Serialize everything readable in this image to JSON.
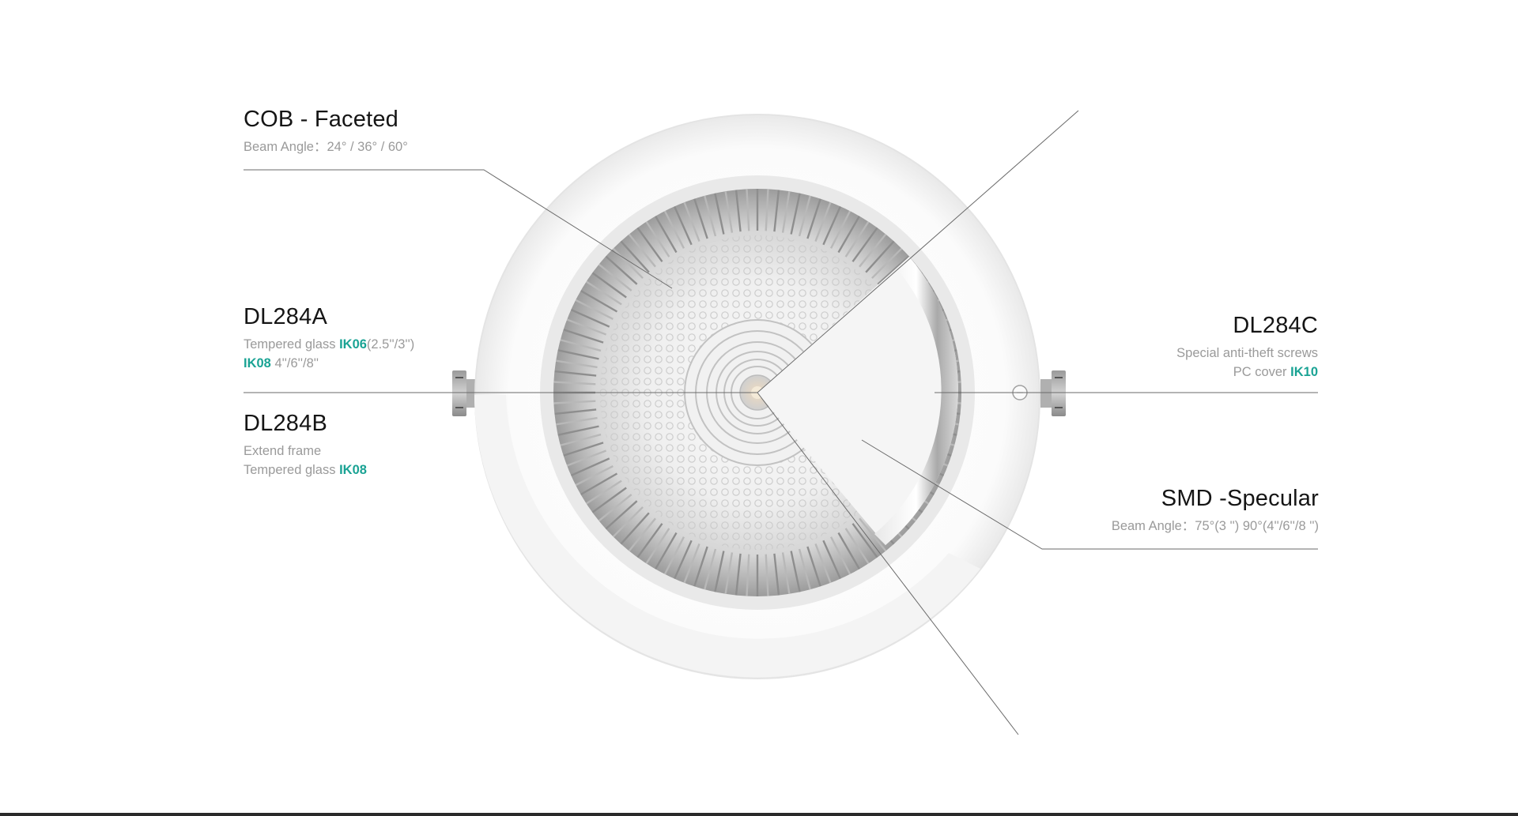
{
  "colors": {
    "accent": "#1aa394",
    "title": "#151515",
    "muted": "#9a9a9a",
    "leader_line": "#6a6a6a"
  },
  "labels": {
    "cob": {
      "title": "COB - Faceted",
      "line1": "Beam Angle：24° / 36° / 60°"
    },
    "dl284a": {
      "title": "DL284A",
      "line1_pre": "Tempered glass ",
      "line1_accent": "IK06",
      "line1_post": "(2.5''/3'')",
      "line2_accent": "IK08",
      "line2_post": " 4''/6''/8''"
    },
    "dl284b": {
      "title": "DL284B",
      "line1": "Extend frame",
      "line2_pre": "Tempered glass ",
      "line2_accent": "IK08"
    },
    "dl284c": {
      "title": "DL284C",
      "line1": "Special anti-theft screws",
      "line2_pre": "PC cover ",
      "line2_accent": "IK10"
    },
    "smd": {
      "title": "SMD -Specular",
      "line1": "Beam Angle：75°(3 '') 90°(4''/6''/8 '')"
    }
  }
}
